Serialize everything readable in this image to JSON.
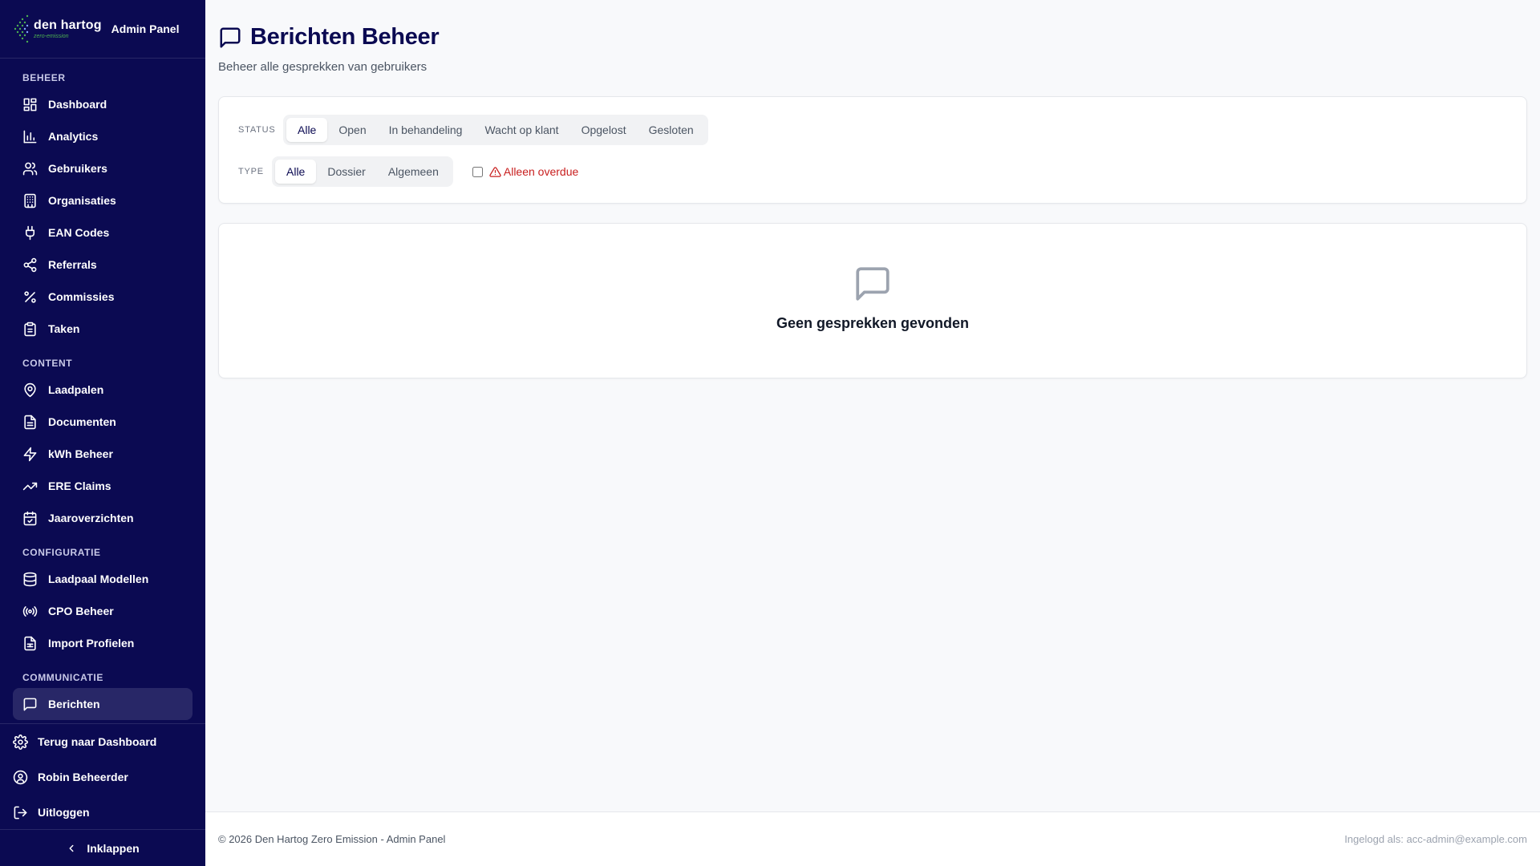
{
  "brand": {
    "name": "den hartog",
    "tagline": "zero-emission",
    "panel": "Admin Panel"
  },
  "sidebar": {
    "sections": [
      {
        "title": "BEHEER",
        "items": [
          {
            "label": "Dashboard",
            "icon": "dashboard-icon"
          },
          {
            "label": "Analytics",
            "icon": "bar-chart-icon"
          },
          {
            "label": "Gebruikers",
            "icon": "users-icon"
          },
          {
            "label": "Organisaties",
            "icon": "building-icon"
          },
          {
            "label": "EAN Codes",
            "icon": "plug-icon"
          },
          {
            "label": "Referrals",
            "icon": "share-icon"
          },
          {
            "label": "Commissies",
            "icon": "percent-icon"
          },
          {
            "label": "Taken",
            "icon": "clipboard-icon"
          }
        ]
      },
      {
        "title": "CONTENT",
        "items": [
          {
            "label": "Laadpalen",
            "icon": "map-pin-icon"
          },
          {
            "label": "Documenten",
            "icon": "document-icon"
          },
          {
            "label": "kWh Beheer",
            "icon": "lightning-icon"
          },
          {
            "label": "ERE Claims",
            "icon": "trending-up-icon"
          },
          {
            "label": "Jaaroverzichten",
            "icon": "calendar-check-icon"
          }
        ]
      },
      {
        "title": "CONFIGURATIE",
        "items": [
          {
            "label": "Laadpaal Modellen",
            "icon": "database-icon"
          },
          {
            "label": "CPO Beheer",
            "icon": "radio-icon"
          },
          {
            "label": "Import Profielen",
            "icon": "file-spreadsheet-icon"
          }
        ]
      },
      {
        "title": "COMMUNICATIE",
        "items": [
          {
            "label": "Berichten",
            "icon": "message-icon"
          }
        ]
      }
    ],
    "bottom": {
      "back": "Terug naar Dashboard",
      "user": "Robin Beheerder",
      "logout": "Uitloggen",
      "collapse": "Inklappen"
    }
  },
  "header": {
    "title": "Berichten Beheer",
    "subtitle": "Beheer alle gesprekken van gebruikers"
  },
  "filters": {
    "status_label": "STATUS",
    "status_options": [
      "Alle",
      "Open",
      "In behandeling",
      "Wacht op klant",
      "Opgelost",
      "Gesloten"
    ],
    "status_selected": "Alle",
    "type_label": "TYPE",
    "type_options": [
      "Alle",
      "Dossier",
      "Algemeen"
    ],
    "type_selected": "Alle",
    "overdue_label": "Alleen overdue",
    "overdue_checked": false
  },
  "empty_state": {
    "text": "Geen gesprekken gevonden"
  },
  "footer": {
    "copyright": "© 2026 Den Hartog Zero Emission - Admin Panel",
    "logged_in": "Ingelogd als: acc-admin@example.com"
  },
  "colors": {
    "sidebar": "#0b0a52",
    "accent": "#0b0a52",
    "danger": "#c81e1e"
  }
}
